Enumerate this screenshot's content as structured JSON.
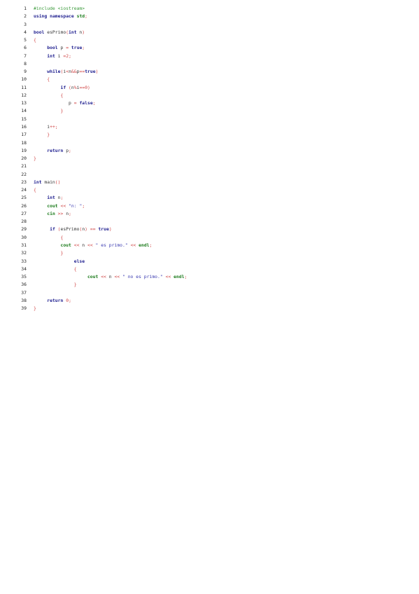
{
  "document": {
    "lines": [
      {
        "n": "1",
        "t": [
          [
            "pp",
            "#include <iostream>"
          ]
        ]
      },
      {
        "n": "2",
        "t": [
          [
            "kw",
            "using"
          ],
          [
            "id",
            " "
          ],
          [
            "kw",
            "namespace"
          ],
          [
            "id",
            " "
          ],
          [
            "kw2",
            "std"
          ],
          [
            "op",
            ";"
          ]
        ]
      },
      {
        "n": "3",
        "t": []
      },
      {
        "n": "4",
        "t": [
          [
            "kw",
            "bool"
          ],
          [
            "id",
            " esPrimo"
          ],
          [
            "br",
            "("
          ],
          [
            "kw",
            "int"
          ],
          [
            "id",
            " n"
          ],
          [
            "br",
            ")"
          ]
        ]
      },
      {
        "n": "5",
        "t": [
          [
            "br",
            "{"
          ]
        ]
      },
      {
        "n": "6",
        "t": [
          [
            "id",
            "     "
          ],
          [
            "kw",
            "bool"
          ],
          [
            "id",
            " p "
          ],
          [
            "op",
            "="
          ],
          [
            "id",
            " "
          ],
          [
            "kw",
            "true"
          ],
          [
            "op",
            ";"
          ]
        ]
      },
      {
        "n": "7",
        "t": [
          [
            "id",
            "     "
          ],
          [
            "kw",
            "int"
          ],
          [
            "id",
            " i "
          ],
          [
            "op",
            "="
          ],
          [
            "num",
            "2"
          ],
          [
            "op",
            ";"
          ]
        ]
      },
      {
        "n": "8",
        "t": []
      },
      {
        "n": "9",
        "t": [
          [
            "id",
            "     "
          ],
          [
            "kw",
            "while"
          ],
          [
            "br",
            "("
          ],
          [
            "id",
            "i"
          ],
          [
            "op",
            "<"
          ],
          [
            "id",
            "n"
          ],
          [
            "op",
            "&&"
          ],
          [
            "id",
            "p"
          ],
          [
            "op",
            "=="
          ],
          [
            "kw",
            "true"
          ],
          [
            "br",
            ")"
          ]
        ]
      },
      {
        "n": "10",
        "t": [
          [
            "id",
            "     "
          ],
          [
            "br",
            "{"
          ]
        ]
      },
      {
        "n": "11",
        "t": [
          [
            "id",
            "          "
          ],
          [
            "kw",
            "if"
          ],
          [
            "id",
            " "
          ],
          [
            "br",
            "("
          ],
          [
            "id",
            "n"
          ],
          [
            "op",
            "%"
          ],
          [
            "id",
            "i"
          ],
          [
            "op",
            "=="
          ],
          [
            "num",
            "0"
          ],
          [
            "br",
            ")"
          ]
        ]
      },
      {
        "n": "12",
        "t": [
          [
            "id",
            "          "
          ],
          [
            "br",
            "{"
          ]
        ]
      },
      {
        "n": "13",
        "t": [
          [
            "id",
            "             p "
          ],
          [
            "op",
            "="
          ],
          [
            "id",
            " "
          ],
          [
            "kw",
            "false"
          ],
          [
            "op",
            ";"
          ]
        ]
      },
      {
        "n": "14",
        "t": [
          [
            "id",
            "          "
          ],
          [
            "br",
            "}"
          ]
        ]
      },
      {
        "n": "15",
        "t": []
      },
      {
        "n": "16",
        "t": [
          [
            "id",
            "     i"
          ],
          [
            "op",
            "++;"
          ]
        ]
      },
      {
        "n": "17",
        "t": [
          [
            "id",
            "     "
          ],
          [
            "br",
            "}"
          ]
        ]
      },
      {
        "n": "18",
        "t": []
      },
      {
        "n": "19",
        "t": [
          [
            "id",
            "     "
          ],
          [
            "kw",
            "return"
          ],
          [
            "id",
            " p"
          ],
          [
            "op",
            ";"
          ]
        ]
      },
      {
        "n": "20",
        "t": [
          [
            "br",
            "}"
          ]
        ]
      },
      {
        "n": "21",
        "t": []
      },
      {
        "n": "22",
        "t": []
      },
      {
        "n": "23",
        "t": [
          [
            "kw",
            "int"
          ],
          [
            "id",
            " main"
          ],
          [
            "br",
            "()"
          ]
        ]
      },
      {
        "n": "24",
        "t": [
          [
            "br",
            "{"
          ]
        ]
      },
      {
        "n": "25",
        "t": [
          [
            "id",
            "     "
          ],
          [
            "kw",
            "int"
          ],
          [
            "id",
            " n"
          ],
          [
            "op",
            ";"
          ]
        ]
      },
      {
        "n": "26",
        "t": [
          [
            "id",
            "     "
          ],
          [
            "kw2",
            "cout"
          ],
          [
            "id",
            " "
          ],
          [
            "op",
            "<<"
          ],
          [
            "id",
            " "
          ],
          [
            "str",
            "\"n: \""
          ],
          [
            "op",
            ";"
          ]
        ]
      },
      {
        "n": "27",
        "t": [
          [
            "id",
            "     "
          ],
          [
            "kw2",
            "cin"
          ],
          [
            "id",
            " "
          ],
          [
            "op",
            ">>"
          ],
          [
            "id",
            " n"
          ],
          [
            "op",
            ";"
          ]
        ]
      },
      {
        "n": "28",
        "t": []
      },
      {
        "n": "29",
        "t": [
          [
            "id",
            "      "
          ],
          [
            "kw",
            "if"
          ],
          [
            "id",
            " "
          ],
          [
            "br",
            "("
          ],
          [
            "id",
            "esPrimo"
          ],
          [
            "br",
            "("
          ],
          [
            "id",
            "n"
          ],
          [
            "br",
            ")"
          ],
          [
            "id",
            " "
          ],
          [
            "op",
            "=="
          ],
          [
            "id",
            " "
          ],
          [
            "kw",
            "true"
          ],
          [
            "br",
            ")"
          ]
        ]
      },
      {
        "n": "30",
        "t": [
          [
            "id",
            "          "
          ],
          [
            "br",
            "{"
          ]
        ]
      },
      {
        "n": "31",
        "t": [
          [
            "id",
            "          "
          ],
          [
            "kw2",
            "cout"
          ],
          [
            "id",
            " "
          ],
          [
            "op",
            "<<"
          ],
          [
            "id",
            " n "
          ],
          [
            "op",
            "<<"
          ],
          [
            "id",
            " "
          ],
          [
            "str",
            "\" es primo.\""
          ],
          [
            "id",
            " "
          ],
          [
            "op",
            "<<"
          ],
          [
            "id",
            " "
          ],
          [
            "kw2",
            "endl"
          ],
          [
            "op",
            ";"
          ]
        ]
      },
      {
        "n": "32",
        "t": [
          [
            "id",
            "          "
          ],
          [
            "br",
            "}"
          ]
        ]
      },
      {
        "n": "33",
        "t": [
          [
            "id",
            "               "
          ],
          [
            "kw",
            "else"
          ]
        ]
      },
      {
        "n": "34",
        "t": [
          [
            "id",
            "               "
          ],
          [
            "br",
            "{"
          ]
        ]
      },
      {
        "n": "35",
        "t": [
          [
            "id",
            "                    "
          ],
          [
            "kw2",
            "cout"
          ],
          [
            "id",
            " "
          ],
          [
            "op",
            "<<"
          ],
          [
            "id",
            " n "
          ],
          [
            "op",
            "<<"
          ],
          [
            "id",
            " "
          ],
          [
            "str",
            "\" no es primo.\""
          ],
          [
            "id",
            " "
          ],
          [
            "op",
            "<<"
          ],
          [
            "id",
            " "
          ],
          [
            "kw2",
            "endl"
          ],
          [
            "op",
            ";"
          ]
        ]
      },
      {
        "n": "36",
        "t": [
          [
            "id",
            "               "
          ],
          [
            "br",
            "}"
          ]
        ]
      },
      {
        "n": "37",
        "t": []
      },
      {
        "n": "38",
        "t": [
          [
            "id",
            "     "
          ],
          [
            "kw",
            "return"
          ],
          [
            "id",
            " "
          ],
          [
            "num",
            "0"
          ],
          [
            "op",
            ";"
          ]
        ]
      },
      {
        "n": "39",
        "t": [
          [
            "br",
            "}"
          ]
        ]
      }
    ]
  },
  "colors": {
    "keyword": "#1f1f8f",
    "std_identifier": "#1a7a1a",
    "preprocessor": "#3a9a3a",
    "string": "#3a3ab0",
    "number_operator_bracket": "#d04545",
    "identifier": "#333333"
  }
}
